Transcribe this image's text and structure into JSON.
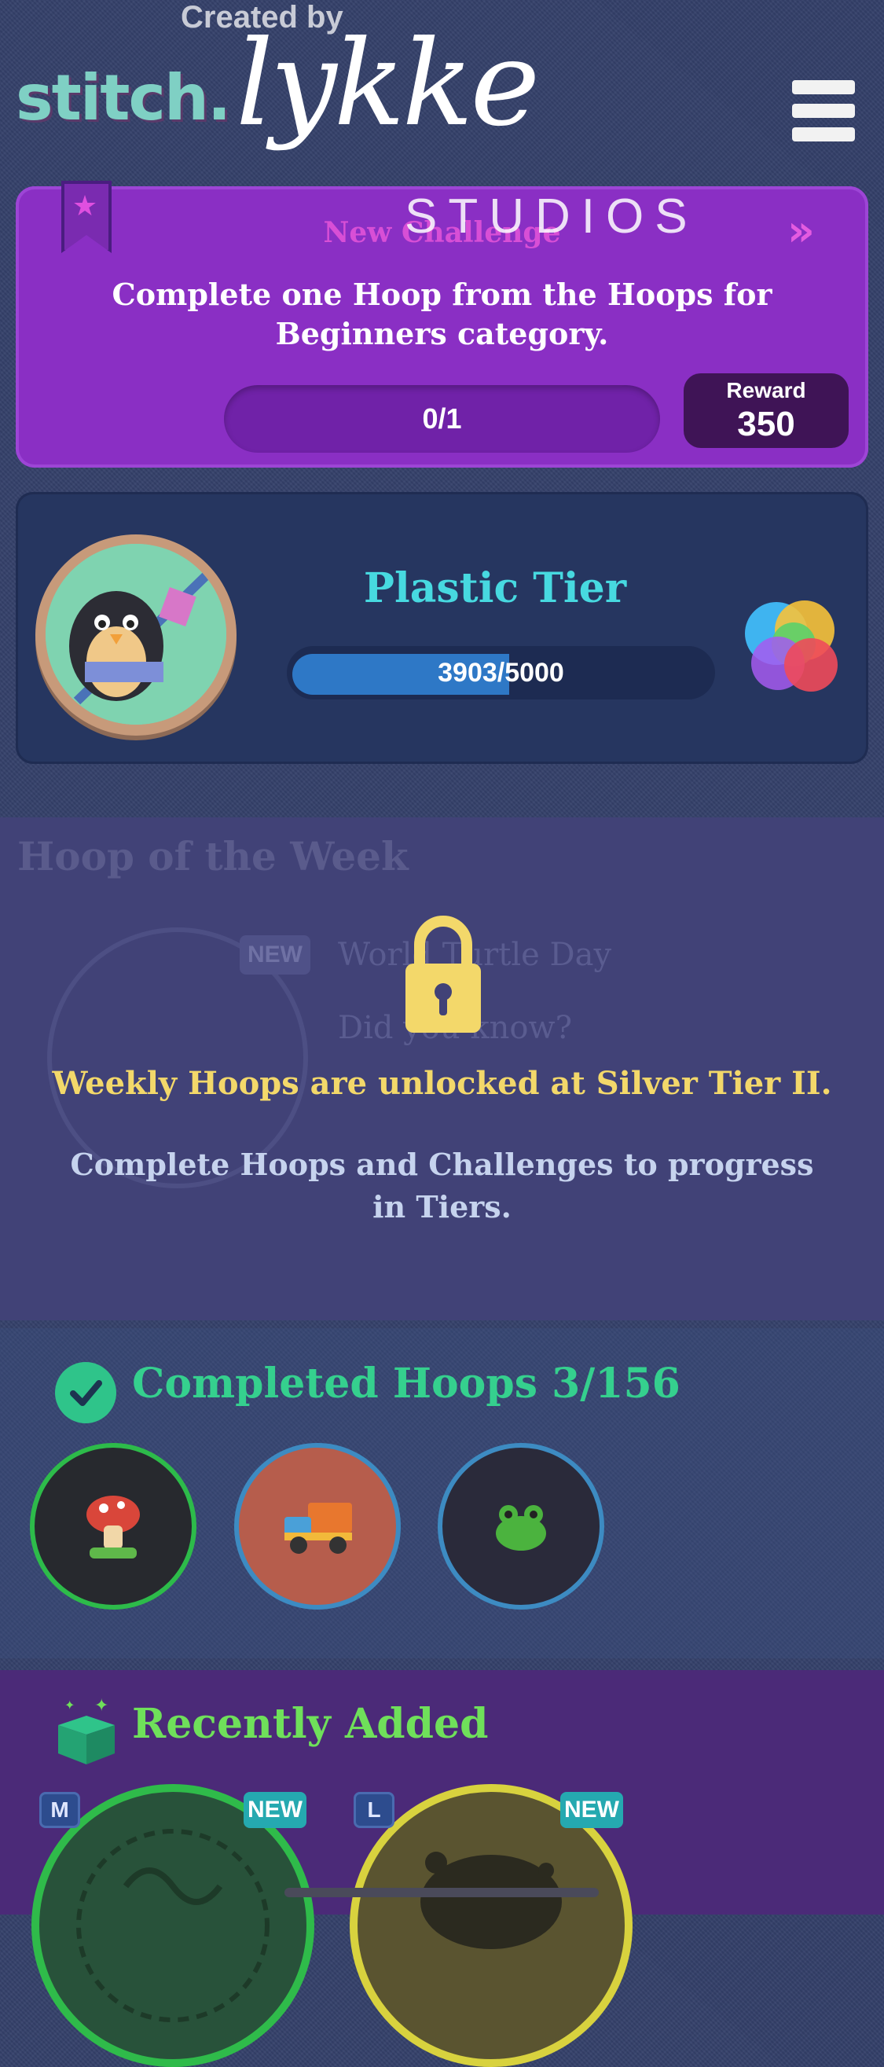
{
  "header": {
    "created_by": "Created by",
    "stitch_logo": "stitch.",
    "lykke_logo": "lykke",
    "studios_logo": "STUDIOS",
    "menu_icon": "hamburger-menu-icon"
  },
  "challenge": {
    "title": "New Challenge",
    "description": "Complete one Hoop from the Hoops for Beginners category.",
    "progress_text": "0/1",
    "progress_fraction": 0,
    "reward_label": "Reward",
    "reward_value": "350",
    "colors": {
      "panel": "#8a2fc4",
      "title": "#d84fd6"
    }
  },
  "tier": {
    "name": "Plastic Tier",
    "progress_text": "3903/5000",
    "progress_fraction": 0.7806,
    "colors": {
      "name": "#47d9e0",
      "bar": "#2e78c6"
    }
  },
  "hoop_of_week": {
    "title": "Hoop of the Week",
    "badge": "NEW",
    "ghost_line1": "World Turtle Day",
    "ghost_line2": "Did you know?",
    "lock_message": "Weekly Hoops are unlocked at Silver Tier II.",
    "lock_subtext": "Complete Hoops and Challenges to progress in Tiers.",
    "colors": {
      "message": "#f3d86a"
    }
  },
  "completed": {
    "title": "Completed Hoops 3/156",
    "items": [
      {
        "icon": "mushroom-icon"
      },
      {
        "icon": "dump-truck-icon"
      },
      {
        "icon": "frog-icon"
      }
    ]
  },
  "recent": {
    "title": "Recently Added",
    "items": [
      {
        "size": "M",
        "badge": "NEW"
      },
      {
        "size": "L",
        "badge": "NEW"
      }
    ]
  }
}
